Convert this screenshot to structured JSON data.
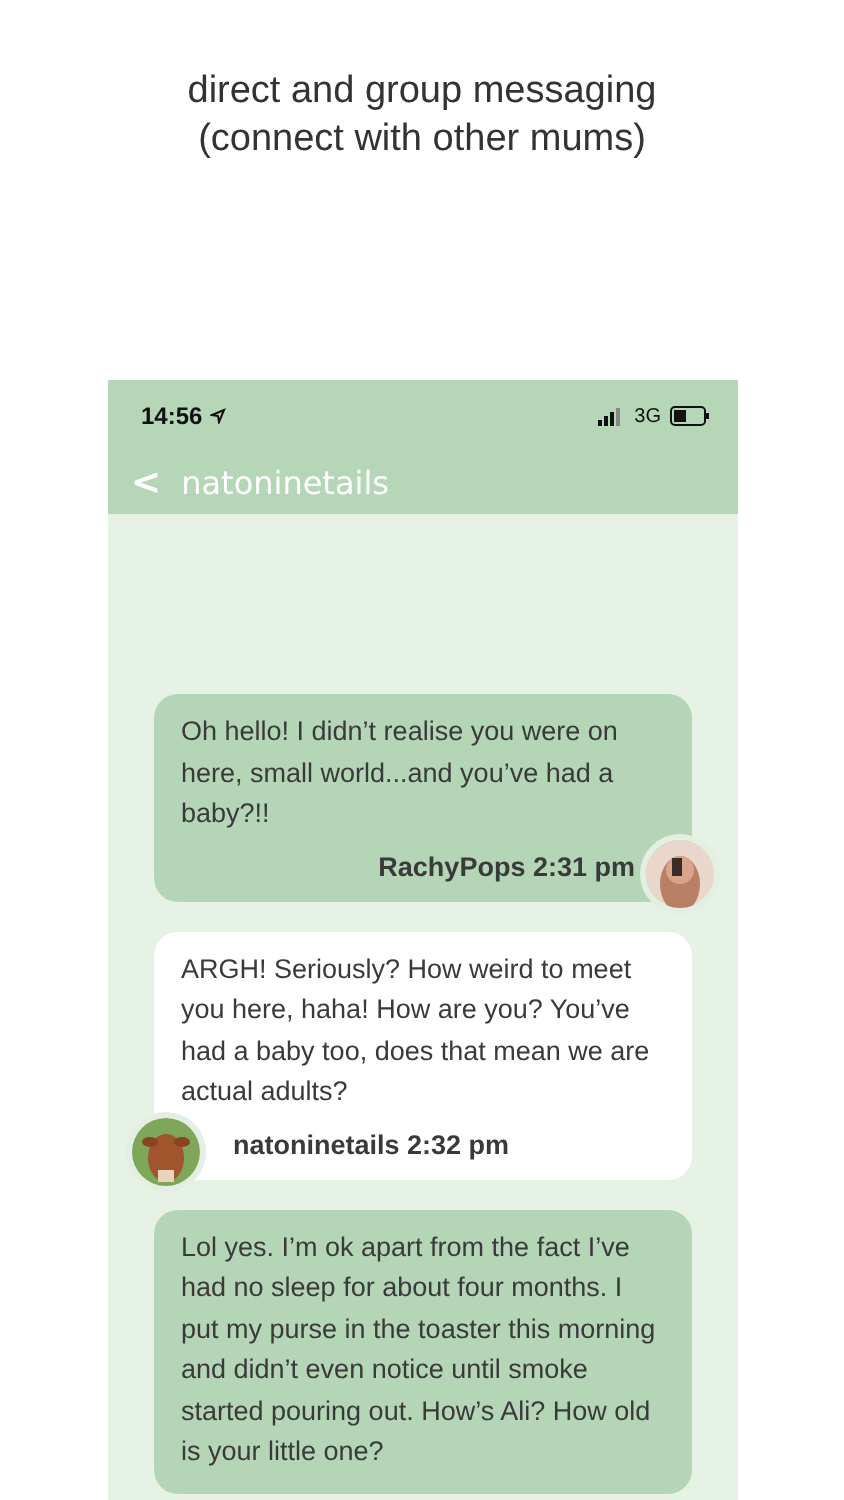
{
  "caption": [
    "direct and group messaging",
    "(connect with other mums)"
  ],
  "status_bar": {
    "time": "14:56",
    "network": "3G"
  },
  "nav": {
    "back": "<",
    "title": "natoninetails"
  },
  "messages": [
    {
      "kind": "sent",
      "text": "Oh hello! I didn’t realise you were on here, small world...and you’ve had a baby?!!",
      "author": "RachyPops",
      "time": "2:31 pm"
    },
    {
      "kind": "received",
      "text": "ARGH! Seriously? How weird to meet you here, haha! How are you? You’ve had a baby too, does that mean we are actual adults?",
      "author": "natoninetails",
      "time": "2:32 pm"
    },
    {
      "kind": "sent",
      "text": "Lol yes. I’m ok apart from the fact I’ve had no sleep for about four months. I put my purse in the toaster this morning and didn’t even notice until smoke started pouring out. How’s Ali? How old is your little one?"
    }
  ]
}
